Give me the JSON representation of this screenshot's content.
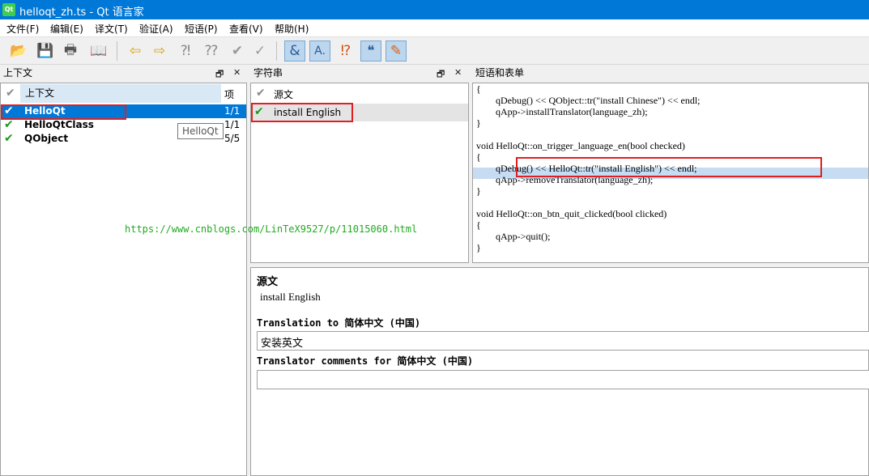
{
  "window": {
    "title": "helloqt_zh.ts - Qt 语言家",
    "app_icon": "Qt"
  },
  "menu": [
    "文件(F)",
    "编辑(E)",
    "译文(T)",
    "验证(A)",
    "短语(P)",
    "查看(V)",
    "帮助(H)"
  ],
  "toolbar": {
    "icons": [
      "open-folder-icon",
      "save-icon",
      "print-icon",
      "phrasebook-icon",
      "prev-icon",
      "next-icon",
      "prev-unfinished-icon",
      "next-unfinished-icon",
      "done-icon",
      "done-next-icon",
      "accelerator-icon",
      "ending-punctuation-icon",
      "phrase-match-icon",
      "place-marker-icon",
      "surrounding-whitespace-icon"
    ]
  },
  "context_panel": {
    "title": "上下文",
    "header_context": "上下文",
    "header_items": "项",
    "rows": [
      {
        "name": "HelloQt",
        "items": "1/1"
      },
      {
        "name": "HelloQtClass",
        "items": "1/1"
      },
      {
        "name": "QObject",
        "items": "5/5"
      }
    ],
    "tooltip": "HelloQt"
  },
  "strings_panel": {
    "title": "字符串",
    "header_source": "源文",
    "rows": [
      {
        "source": "install English"
      }
    ]
  },
  "phrases_panel": {
    "title": "短语和表单",
    "code_lines": [
      "{",
      "        qDebug() << QObject::tr(\"install Chinese\") << endl;",
      "        qApp->installTranslator(language_zh);",
      "}",
      "",
      "void HelloQt::on_trigger_language_en(bool checked)",
      "{",
      "        qDebug() << HelloQt::tr(\"install English\") << endl;",
      "        qApp->removeTranslator(language_zh);",
      "}",
      "",
      "void HelloQt::on_btn_quit_clicked(bool clicked)",
      "{",
      "        qApp->quit();",
      "}"
    ],
    "highlighted_line_index": 7
  },
  "watermark": "https://www.cnblogs.com/LinTeX9527/p/11015060.html",
  "editor": {
    "source_label": "源文",
    "source_text": "install English",
    "translation_label": "Translation to 简体中文 (中国)",
    "translation_value": "安装英文",
    "comments_label": "Translator comments for 简体中文 (中国)",
    "comments_value": ""
  },
  "colors": {
    "titlebar": "#0078d7",
    "selection": "#0078d7",
    "highlight_line": "#c5dcf2",
    "redbox": "#e02020",
    "watermark": "#22aa22"
  }
}
